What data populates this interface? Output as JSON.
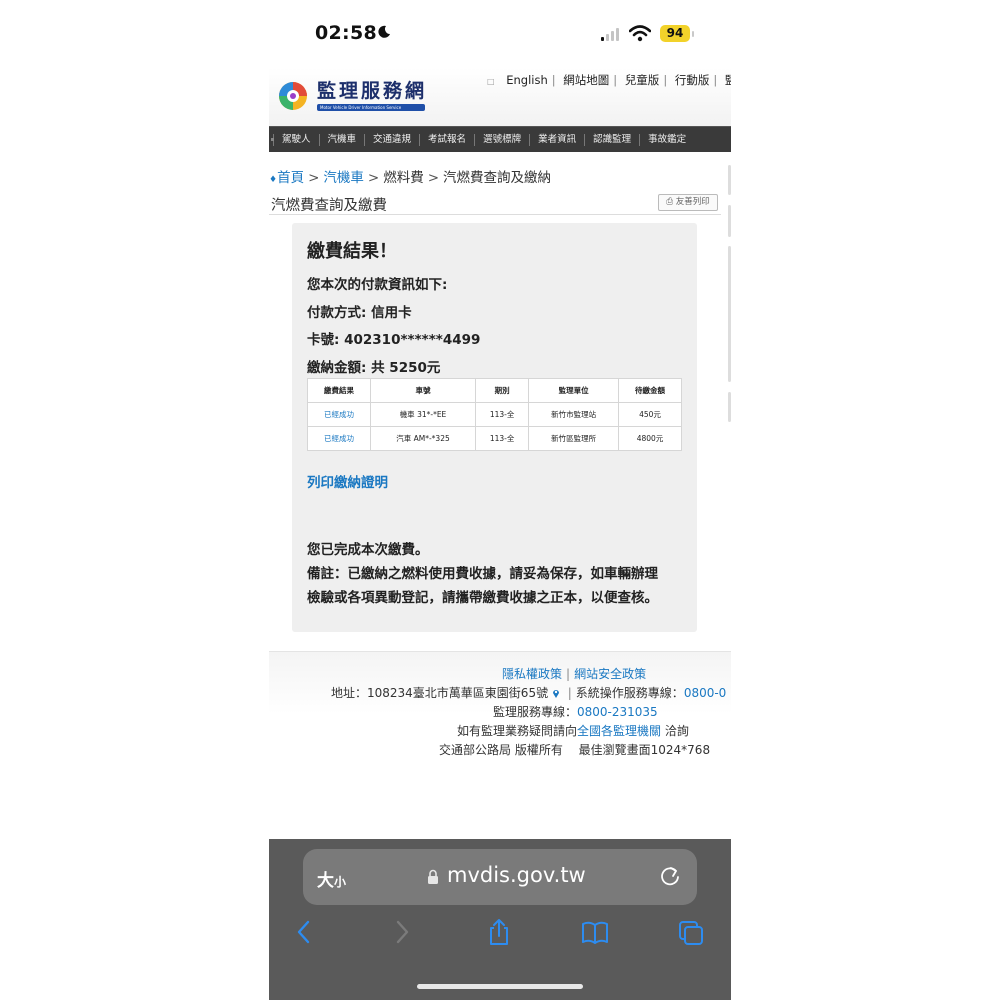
{
  "status_bar": {
    "time": "02:58",
    "battery": "94"
  },
  "header": {
    "logo_title": "監理服務網",
    "logo_subtitle": "Motor Vehicle Driver Information Service",
    "top_links": [
      "English",
      "網站地圖",
      "兒童版",
      "行動版",
      "監理"
    ]
  },
  "nav": {
    "items": [
      "駕駛人",
      "汽機車",
      "交通違規",
      "考試報名",
      "選號標牌",
      "業者資訊",
      "認識監理",
      "事故鑑定"
    ]
  },
  "breadcrumb": {
    "home": "首頁",
    "level1": "汽機車",
    "level2": "燃料費",
    "current": "汽燃費查詢及繳納"
  },
  "page": {
    "title": "汽燃費查詢及繳費",
    "print_label": "友善列印"
  },
  "result": {
    "heading": "繳費結果！",
    "intro": "您本次的付款資訊如下:",
    "method": "付款方式: 信用卡",
    "card": "卡號: 402310******4499",
    "amount": "繳納金額: 共 5250元",
    "table": {
      "headers": [
        "繳費結果",
        "車號",
        "期別",
        "監理單位",
        "待繳金額"
      ],
      "rows": [
        [
          "已經成功",
          "機車 31*-*EE",
          "113-全",
          "新竹市監理站",
          "450元"
        ],
        [
          "已經成功",
          "汽車 AM*-*325",
          "113-全",
          "新竹區監理所",
          "4800元"
        ]
      ]
    },
    "print_certificate": "列印繳納證明",
    "done": "您已完成本次繳費。",
    "note_line1": "備註：已繳納之燃料使用費收據，請妥為保存，如車輛辦理",
    "note_line2": "檢驗或各項異動登記，請攜帶繳費收據之正本，以便查核。"
  },
  "footer": {
    "privacy": "隱私權政策",
    "security": "網站安全政策",
    "address_prefix": "地址：108234臺北市萬華區東園街65號",
    "hotline_label": "系統操作服務專線：",
    "hotline": "0800-0",
    "service_label": "監理服務專線：",
    "service": "0800-231035",
    "inquiry_prefix": "如有監理業務疑問請向",
    "inquiry_link": "全國各監理機關",
    "inquiry_suffix": " 洽詢",
    "copyright": "交通部公路局 版權所有　 最佳瀏覽畫面1024*768"
  },
  "browser": {
    "text_size_big": "大",
    "text_size_small": "小",
    "url": "mvdis.gov.tw"
  }
}
